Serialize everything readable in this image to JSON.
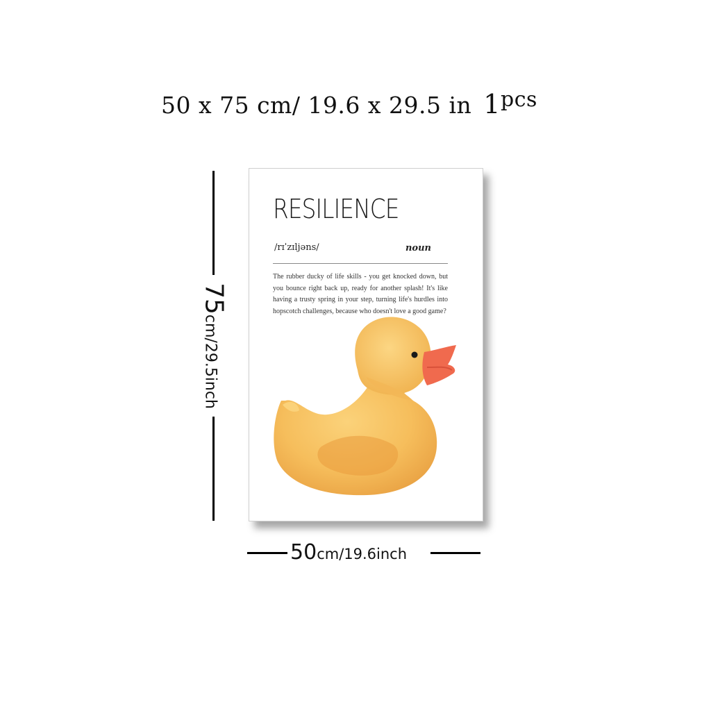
{
  "headline": {
    "size_text": "50 x 75 cm/ 19.6 x 29.5 in",
    "qty_number": "1",
    "qty_unit": "pcs"
  },
  "height_label": {
    "big": "75",
    "small": "cm/29.5inch"
  },
  "width_label": {
    "big": "50",
    "small": "cm/19.6inch"
  },
  "poster": {
    "title": "RESILIENCE",
    "phonetic": "/rɪˈzɪljəns/",
    "part_of_speech": "noun",
    "definition": "The rubber ducky of life skills - you get knocked down, but you bounce right back up, ready for another splash! It's like having a trusty spring in your step, turning life's hurdles into hopscotch challenges, because who doesn't love a good game?",
    "illustration": "rubber-duck-watercolor"
  },
  "colors": {
    "duck_body": "#f6be5c",
    "duck_shade": "#e99a3c",
    "beak": "#f06a4e"
  }
}
